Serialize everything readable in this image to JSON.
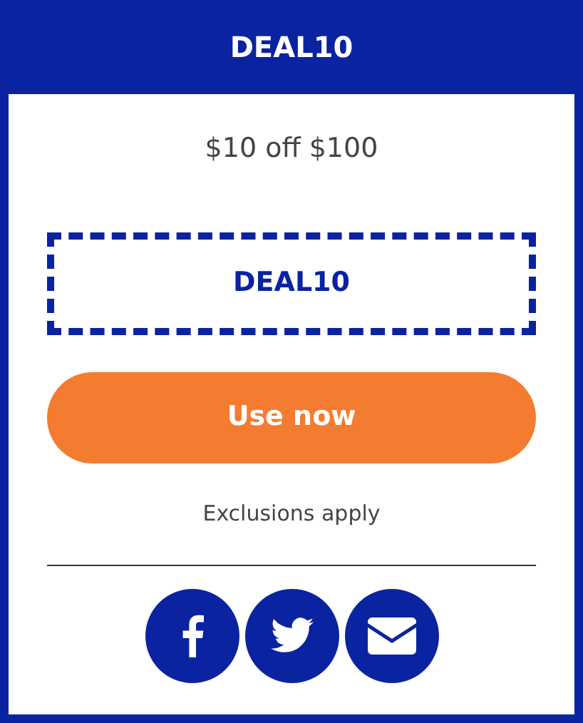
{
  "header": {
    "title": "DEAL10"
  },
  "offer": "$10 off $100",
  "code": "DEAL10",
  "button": "Use now",
  "note": "Exclusions apply",
  "share_buttons": [
    {
      "kind": "facebook"
    },
    {
      "kind": "twitter"
    },
    {
      "kind": "email"
    }
  ]
}
